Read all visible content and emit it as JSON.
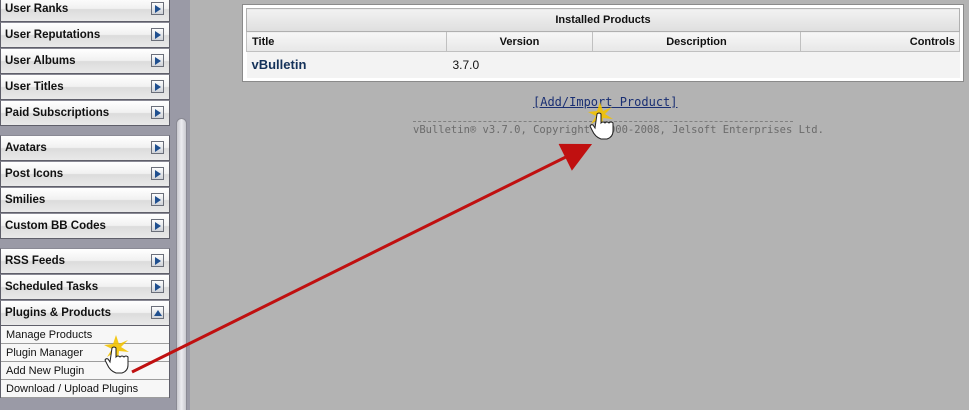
{
  "sidebar": {
    "groups": [
      [
        "User Ranks",
        "User Reputations",
        "User Albums",
        "User Titles",
        "Paid Subscriptions"
      ],
      [
        "Avatars",
        "Post Icons",
        "Smilies",
        "Custom BB Codes"
      ],
      [
        "RSS Feeds",
        "Scheduled Tasks",
        "Plugins & Products"
      ]
    ],
    "expanded": {
      "label": "Plugins & Products",
      "items": [
        "Manage Products",
        "Plugin Manager",
        "Add New Plugin",
        "Download / Upload Plugins"
      ]
    }
  },
  "products_table": {
    "caption": "Installed Products",
    "columns": [
      "Title",
      "Version",
      "Description",
      "Controls"
    ],
    "rows": [
      {
        "title": "vBulletin",
        "version": "3.7.0",
        "description": "",
        "controls": ""
      }
    ]
  },
  "add_link": "[Add/Import Product]",
  "copyright": "vBulletin® v3.7.0, Copyright ©2000-2008, Jelsoft Enterprises Ltd.",
  "annotation": {
    "arrow_color": "#c01010",
    "highlight_color": "#f2c200",
    "cursor": "hand-pointer-icon"
  }
}
